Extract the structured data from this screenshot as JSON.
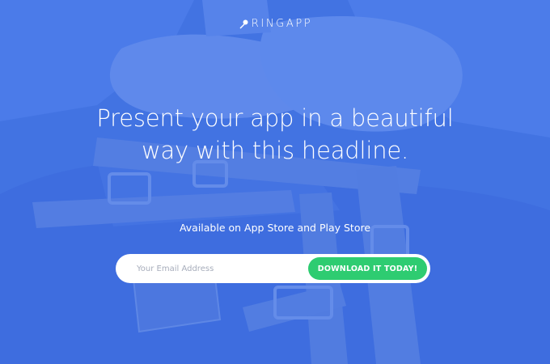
{
  "brand": {
    "name": "RINGAPP",
    "icon": "microphone-icon"
  },
  "hero": {
    "headline_line1": "Present your app in a beautiful",
    "headline_line2": "way with this headline.",
    "subtext": "Available on App Store and Play Store"
  },
  "signup": {
    "email_placeholder": "Your Email Address",
    "email_value": "",
    "button_label": "DOWNLOAD IT TODAY!"
  },
  "colors": {
    "overlay": "#4a78e6",
    "button": "#2ecc71",
    "text": "#ffffff"
  }
}
